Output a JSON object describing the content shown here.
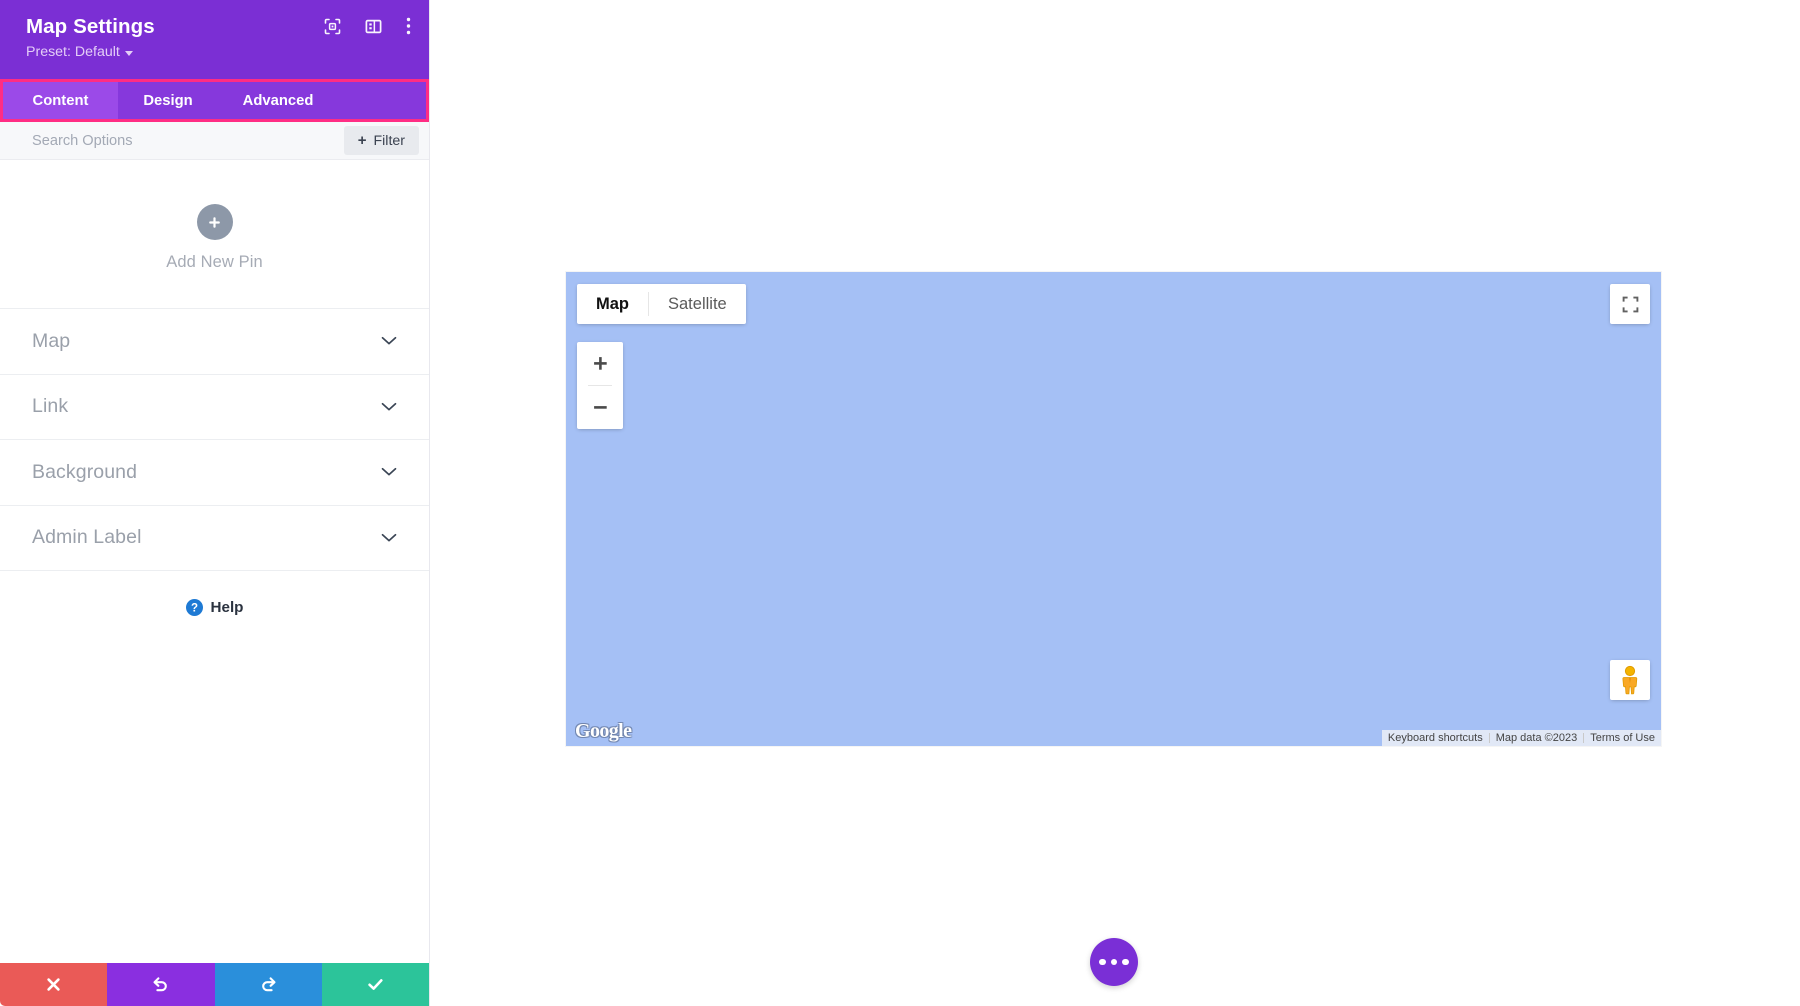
{
  "panel": {
    "title": "Map Settings",
    "preset_label": "Preset: Default",
    "header_icons": [
      {
        "name": "focus-target-icon"
      },
      {
        "name": "layout-panel-icon"
      },
      {
        "name": "more-vertical-icon"
      }
    ],
    "tabs": [
      {
        "label": "Content",
        "active": true
      },
      {
        "label": "Design",
        "active": false
      },
      {
        "label": "Advanced",
        "active": false
      }
    ],
    "search": {
      "placeholder": "Search Options",
      "value": "",
      "filter_label": "Filter",
      "filter_plus": "+"
    },
    "add_pin": {
      "label": "Add New Pin",
      "icon": "plus-icon"
    },
    "accordions": [
      {
        "label": "Map",
        "icon": "chevron-down-icon"
      },
      {
        "label": "Link",
        "icon": "chevron-down-icon"
      },
      {
        "label": "Background",
        "icon": "chevron-down-icon"
      },
      {
        "label": "Admin Label",
        "icon": "chevron-down-icon"
      }
    ],
    "help": {
      "label": "Help",
      "icon": "question-circle-icon"
    },
    "actions": [
      {
        "name": "cancel-button",
        "icon": "close-x-icon",
        "color": "#ea5a57"
      },
      {
        "name": "undo-button",
        "icon": "undo-arrow-icon",
        "color": "#8a2fe0"
      },
      {
        "name": "redo-button",
        "icon": "redo-arrow-icon",
        "color": "#2a8fdb"
      },
      {
        "name": "save-button",
        "icon": "checkmark-icon",
        "color": "#2cc49a"
      }
    ]
  },
  "map": {
    "background_color": "#a5c0f5",
    "type_buttons": [
      {
        "label": "Map",
        "active": true
      },
      {
        "label": "Satellite",
        "active": false
      }
    ],
    "zoom_in_label": "+",
    "zoom_out_label": "−",
    "fullscreen_icon": "fullscreen-expand-icon",
    "pegman_icon": "street-view-pegman-icon",
    "logo_text": "Google",
    "attribution": [
      "Keyboard shortcuts",
      "Map data ©2023",
      "Terms of Use"
    ]
  },
  "fab": {
    "name": "page-settings-fab",
    "icon": "more-horizontal-icon",
    "color": "#7a2fd6"
  },
  "theme": {
    "header_purple": "#7b2fd4",
    "tab_bar_purple": "#8638dc",
    "tab_active_purple": "#9b4ae8",
    "highlight_pink": "#ff2d84"
  }
}
